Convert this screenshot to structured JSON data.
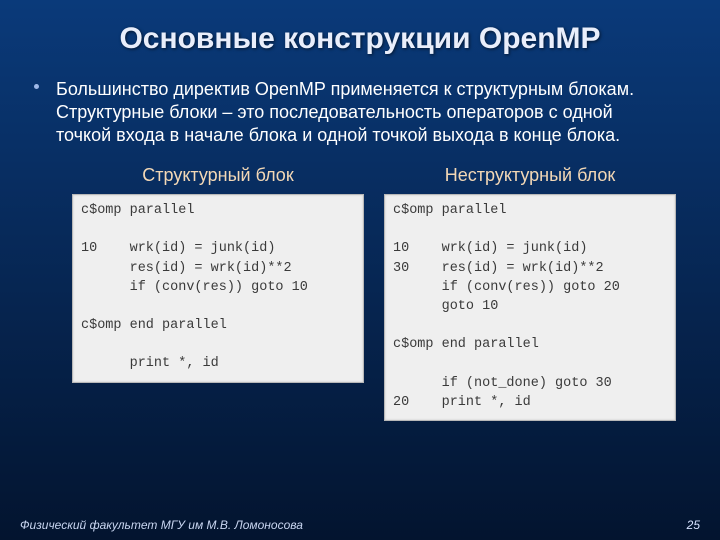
{
  "title": "Основные конструкции OpenMP",
  "bullet": "Большинство директив OpenMP применяется к структурным блокам. Структурные блоки – это последовательность операторов с одной точкой входа в начале блока и одной точкой выхода в конце блока.",
  "left": {
    "heading": "Структурный блок",
    "code": "c$omp parallel\n\n10    wrk(id) = junk(id)\n      res(id) = wrk(id)**2\n      if (conv(res)) goto 10\n\nc$omp end parallel\n\n      print *, id"
  },
  "right": {
    "heading": "Неструктурный блок",
    "code": "c$omp parallel\n\n10    wrk(id) = junk(id)\n30    res(id) = wrk(id)**2\n      if (conv(res)) goto 20\n      goto 10\n\nc$omp end parallel\n\n      if (not_done) goto 30\n20    print *, id"
  },
  "footer": {
    "affiliation": "Физический факультет МГУ им М.В. Ломоносова",
    "page": "25"
  }
}
